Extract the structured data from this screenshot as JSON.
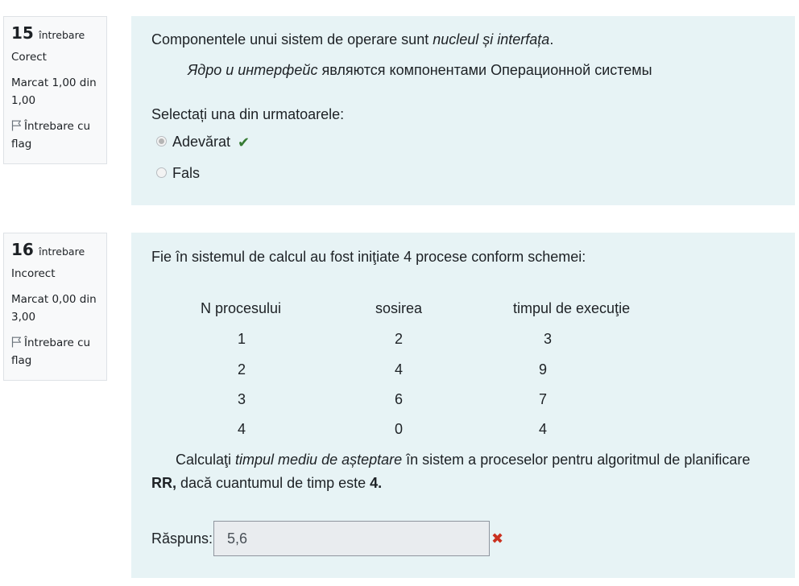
{
  "q15": {
    "info": {
      "number": "15",
      "number_word": "întrebare",
      "state": "Corect",
      "grade": "Marcat 1,00 din 1,00",
      "flag_label": "Întrebare cu flag"
    },
    "statement_plain": "Componentele unui sistem de operare sunt ",
    "statement_italic": "nucleul și interfața",
    "statement_end": ".",
    "ru_italic": "Ядро и интерфейс",
    "ru_plain": " являются компонентами Операционной системы",
    "prompt": "Selectați una din urmatoarele:",
    "options": [
      {
        "label": "Adevărat",
        "selected": true,
        "correct_mark": "✔"
      },
      {
        "label": "Fals",
        "selected": false
      }
    ]
  },
  "q16": {
    "info": {
      "number": "16",
      "number_word": "întrebare",
      "state": "Incorect",
      "grade": "Marcat 0,00 din 3,00",
      "flag_label": "Întrebare cu flag"
    },
    "intro": "Fie în sistemul de calcul au fost iniţiate  4 procese conform schemei:",
    "table": {
      "headers": [
        "N procesului",
        "sosirea",
        "timpul de execuţie"
      ],
      "rows": [
        [
          "1",
          "2",
          "3"
        ],
        [
          "2",
          "4",
          "9"
        ],
        [
          "3",
          "6",
          "7"
        ],
        [
          "4",
          "0",
          "4"
        ]
      ]
    },
    "task_1": "Calculaţi ",
    "task_italic": "timpul mediu de așteptare",
    "task_2": " în sistem a proceselor pentru algoritmul de planificare",
    "task_bold_rr": "RR,",
    "task_3": " dacă cuantumul de timp este ",
    "task_bold_4": "4.",
    "answer_label": "Răspuns:",
    "answer_value": "5,6",
    "wrong_mark": "✖"
  },
  "colors": {
    "content_bg": "#e7f3f5",
    "correct": "#357a32",
    "incorrect": "#ca3120"
  }
}
